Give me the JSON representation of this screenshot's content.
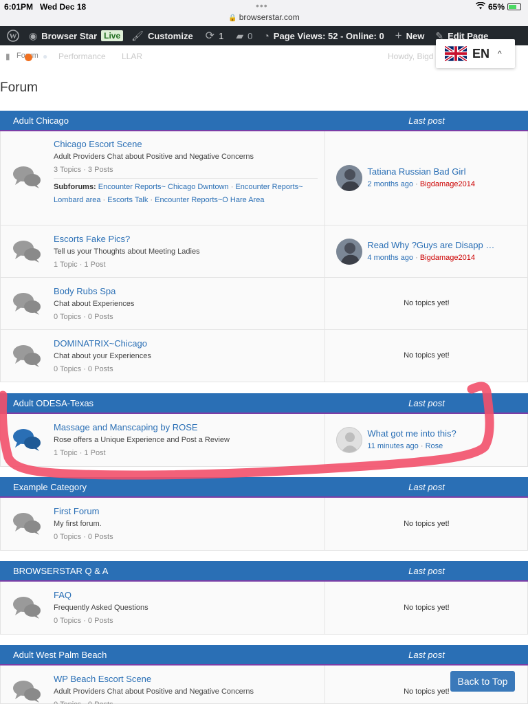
{
  "status_bar": {
    "time": "6:01PM",
    "date": "Wed Dec 18",
    "url": "browserstar.com",
    "battery": "65%"
  },
  "admin_bar": {
    "site_name": "Browser Star",
    "live_badge": "Live",
    "customize": "Customize",
    "updates_count": "1",
    "comments_count": "0",
    "stats": "Page Views: 52 - Online: 0",
    "new_label": "New",
    "edit_page": "Edit Page"
  },
  "site_nav": {
    "forum": "Forum",
    "performance": "Performance",
    "llar": "LLAR",
    "howdy": "Howdy, Bigd"
  },
  "language": {
    "code": "EN"
  },
  "page_title": "Forum",
  "categories": [
    {
      "name": "Adult Chicago",
      "last_post_header": "Last post",
      "forums": [
        {
          "title": "Chicago Escort Scene",
          "description": "Adult Providers Chat about Positive and Negative Concerns",
          "meta": "3 Topics · 3 Posts",
          "subforums_label": "Subforums:",
          "subforums": [
            "Encounter Reports~ Chicago Dwntown",
            "Encounter Reports~ Lombard area",
            "Escorts Talk",
            "Encounter Reports~O Hare Area"
          ],
          "last_post": {
            "title": "Tatiana Russian Bad Girl",
            "time": "2 months ago",
            "author": "Bigdamage2014"
          }
        },
        {
          "title": "Escorts Fake Pics?",
          "description": "Tell us your Thoughts about Meeting Ladies",
          "meta": "1 Topic · 1 Post",
          "last_post": {
            "title": "Read Why ?Guys are Disapp …",
            "time": "4 months ago",
            "author": "Bigdamage2014"
          }
        },
        {
          "title": "Body Rubs Spa",
          "description": "Chat about Experiences",
          "meta": "0 Topics · 0 Posts",
          "no_topics": "No topics yet!"
        },
        {
          "title": "DOMINATRIX~Chicago",
          "description": "Chat about your Experiences",
          "meta": "0 Topics · 0 Posts",
          "no_topics": "No topics yet!"
        }
      ]
    },
    {
      "name": "Adult ODESA-Texas",
      "last_post_header": "Last post",
      "forums": [
        {
          "title": "Massage and Manscaping by ROSE",
          "description": "Rose offers a Unique Experience and Post a Review",
          "meta": "1 Topic · 1 Post",
          "last_post": {
            "title": "What got me into this?",
            "time": "11 minutes ago",
            "author": "Rose"
          }
        }
      ]
    },
    {
      "name": "Example Category",
      "last_post_header": "Last post",
      "forums": [
        {
          "title": "First Forum",
          "description": "My first forum.",
          "meta": "0 Topics · 0 Posts",
          "no_topics": "No topics yet!"
        }
      ]
    },
    {
      "name": "BROWSERSTAR Q & A",
      "last_post_header": "Last post",
      "forums": [
        {
          "title": "FAQ",
          "description": "Frequently Asked Questions",
          "meta": "0 Topics · 0 Posts",
          "no_topics": "No topics yet!"
        }
      ]
    },
    {
      "name": "Adult West Palm Beach",
      "last_post_header": "Last post",
      "forums": [
        {
          "title": "WP Beach Escort Scene",
          "description": "Adult Providers Chat about Positive and Negative Concerns",
          "meta": "0 Topics · 0 Posts",
          "no_topics": "No topics yet!"
        }
      ]
    }
  ],
  "back_to_top": "Back to Top",
  "colors": {
    "category_header": "#2a6fb5",
    "link": "#2a6fb5",
    "author_link": "#cc0000",
    "admin_bar": "#23282d",
    "highlight_marker": "#f2506a"
  },
  "icons": [
    "wordpress-icon",
    "dashboard-icon",
    "brush-icon",
    "refresh-icon",
    "comment-icon",
    "chart-icon",
    "plus-icon",
    "pencil-icon",
    "chat-bubbles-icon",
    "lock-icon",
    "wifi-icon",
    "battery-icon"
  ]
}
